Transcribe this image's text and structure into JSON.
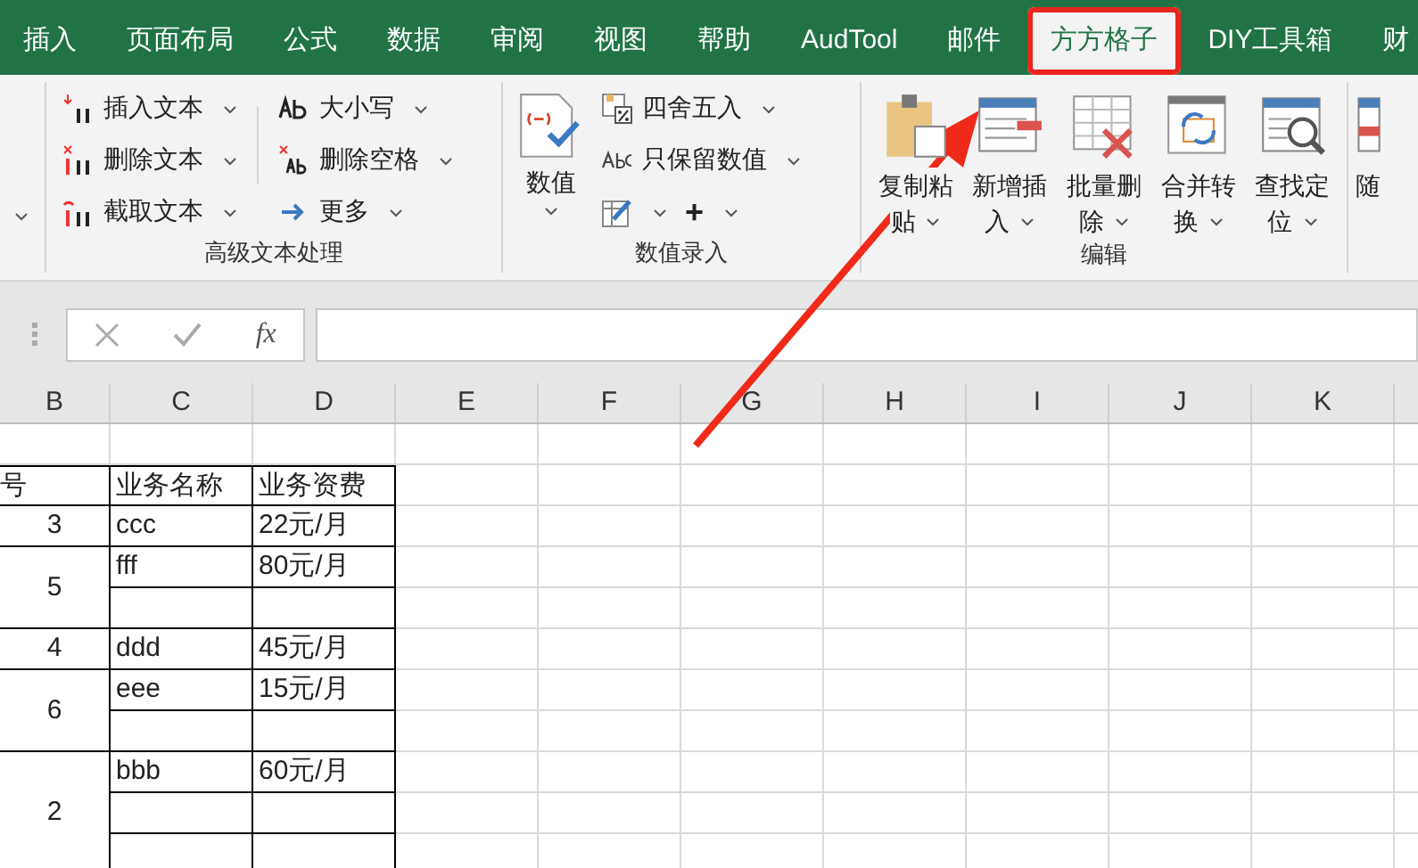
{
  "tabs": [
    {
      "label": "插入",
      "selected": false,
      "highlighted": false
    },
    {
      "label": "页面布局",
      "selected": false,
      "highlighted": false
    },
    {
      "label": "公式",
      "selected": false,
      "highlighted": false
    },
    {
      "label": "数据",
      "selected": false,
      "highlighted": false
    },
    {
      "label": "审阅",
      "selected": false,
      "highlighted": false
    },
    {
      "label": "视图",
      "selected": false,
      "highlighted": false
    },
    {
      "label": "帮助",
      "selected": false,
      "highlighted": false
    },
    {
      "label": "AudTool",
      "selected": false,
      "highlighted": false
    },
    {
      "label": "邮件",
      "selected": false,
      "highlighted": false
    },
    {
      "label": "方方格子",
      "selected": true,
      "highlighted": true
    },
    {
      "label": "DIY工具箱",
      "selected": false,
      "highlighted": false
    },
    {
      "label": "财",
      "selected": false,
      "highlighted": false
    }
  ],
  "ribbon": {
    "text_group": {
      "label": "高级文本处理",
      "column_1": [
        "插入文本",
        "删除文本",
        "截取文本"
      ],
      "column_2": [
        "大小写",
        "删除空格",
        "更多"
      ]
    },
    "number_group": {
      "label": "数值录入",
      "big_button": "数值",
      "small": [
        "四舍五入",
        "只保留数值"
      ],
      "plus": "+"
    },
    "edit_group": {
      "label": "编辑",
      "buttons": [
        {
          "line_1": "复制粘",
          "line_2": "贴"
        },
        {
          "line_1": "新增插",
          "line_2": "入"
        },
        {
          "line_1": "批量删",
          "line_2": "除"
        },
        {
          "line_1": "合并转",
          "line_2": "换"
        },
        {
          "line_1": "查找定",
          "line_2": "位"
        }
      ]
    },
    "partial_button": "随"
  },
  "formula_bar": {
    "fx": "fx"
  },
  "table": {
    "columns": [
      "B",
      "C",
      "D",
      "E",
      "F",
      "G",
      "H",
      "I",
      "J",
      "K"
    ],
    "header": [
      "号",
      "业务名称",
      "业务资费"
    ],
    "groups": [
      {
        "number": "3",
        "items": [
          {
            "name": "ccc",
            "fee": "22元/月"
          }
        ]
      },
      {
        "number": "5",
        "items": [
          {
            "name": "fff",
            "fee": "80元/月"
          },
          {
            "kind": "blank"
          }
        ]
      },
      {
        "number": "4",
        "items": [
          {
            "name": "ddd",
            "fee": "45元/月"
          }
        ]
      },
      {
        "number": "6",
        "items": [
          {
            "name": "eee",
            "fee": "15元/月"
          },
          {
            "kind": "blank"
          }
        ]
      },
      {
        "number": "2",
        "items": [
          {
            "name": "bbb",
            "fee": "60元/月"
          },
          {
            "kind": "blank"
          },
          {
            "kind": "blank"
          }
        ]
      }
    ]
  }
}
